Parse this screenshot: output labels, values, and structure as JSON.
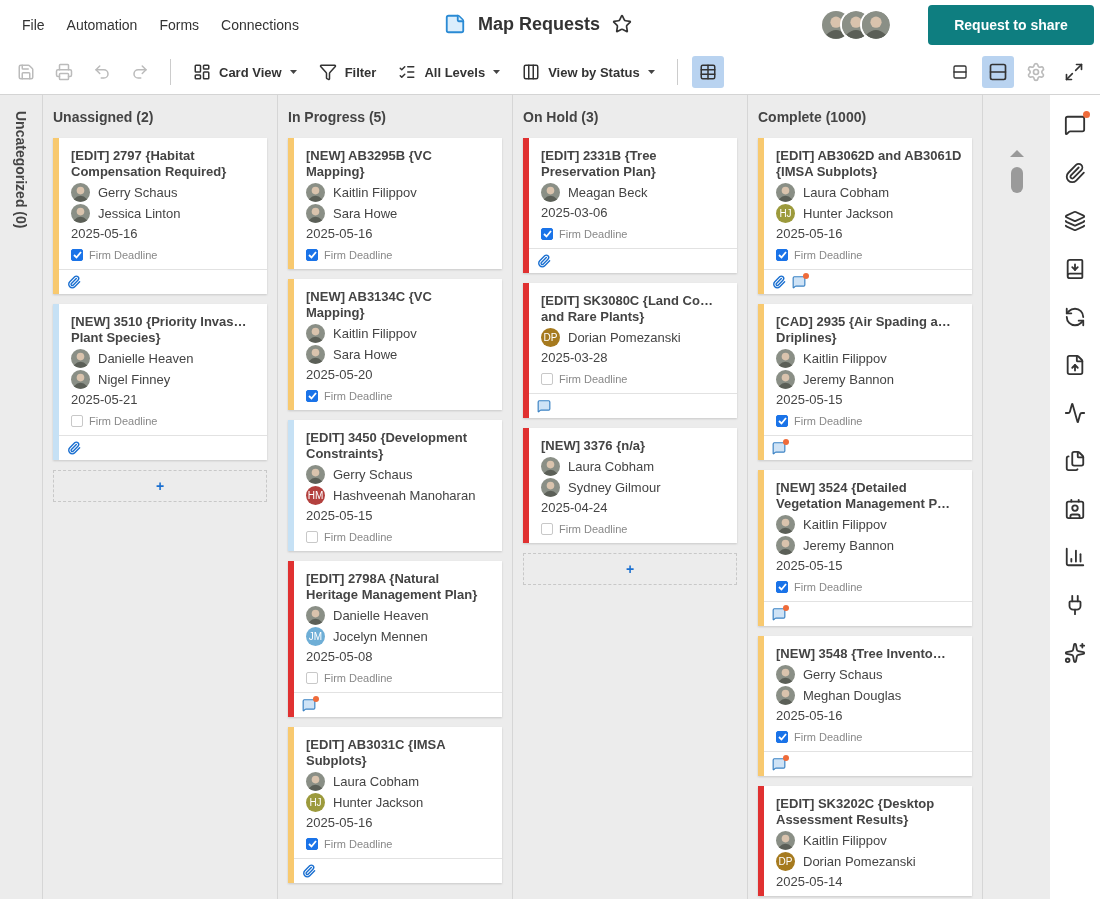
{
  "menu": [
    "File",
    "Automation",
    "Forms",
    "Connections"
  ],
  "title": "Map Requests",
  "starred": false,
  "share_button": "Request to share",
  "collaborators": [
    {
      "kind": "photo"
    },
    {
      "kind": "photo"
    },
    {
      "kind": "photo"
    }
  ],
  "toolbar": {
    "history": [
      {
        "kind": "save",
        "disabled": true
      },
      {
        "kind": "print",
        "disabled": true
      },
      {
        "kind": "undo",
        "disabled": true
      },
      {
        "kind": "redo",
        "disabled": true
      }
    ],
    "controls": [
      {
        "kind": "card-view",
        "label": "Card View",
        "dropdown": true
      },
      {
        "kind": "filter",
        "label": "Filter",
        "dropdown": false
      },
      {
        "kind": "levels",
        "label": "All Levels",
        "dropdown": true
      },
      {
        "kind": "status",
        "label": "View by Status",
        "dropdown": true
      }
    ],
    "grid_toggle": {
      "selected": true
    },
    "right": [
      {
        "kind": "compact",
        "selected": false,
        "disabled": false
      },
      {
        "kind": "expanded",
        "selected": true,
        "disabled": false
      },
      {
        "kind": "settings",
        "selected": false,
        "disabled": true
      },
      {
        "kind": "fullscreen",
        "selected": false,
        "disabled": false
      }
    ]
  },
  "columns": [
    {
      "title": "Uncategorized (0)",
      "collapsed": true
    },
    {
      "title": "Unassigned (2)",
      "collapsed": false,
      "add_label": "+",
      "cards": [
        {
          "title": "[EDIT] 2797 {Habitat Compensation Required}",
          "color": "#f8c96f",
          "people": [
            {
              "name": "Gerry Schaus"
            },
            {
              "name": "Jessica Linton"
            }
          ],
          "date": "2025-05-16",
          "firm_deadline": {
            "label": "Firm Deadline",
            "checked": true
          },
          "footer": [
            {
              "kind": "attachment"
            }
          ]
        },
        {
          "title": "[NEW] 3510 {Priority Invas… Plant Species}",
          "color": "#c6e1f5",
          "people": [
            {
              "name": "Danielle Heaven"
            },
            {
              "name": "Nigel Finney"
            }
          ],
          "date": "2025-05-21",
          "firm_deadline": {
            "label": "Firm Deadline",
            "checked": false
          },
          "footer": [
            {
              "kind": "attachment"
            }
          ]
        }
      ]
    },
    {
      "title": "In Progress (5)",
      "collapsed": false,
      "cards": [
        {
          "title": "[NEW] AB3295B {VC Mapping}",
          "color": "#f8c96f",
          "people": [
            {
              "name": "Kaitlin Filippov"
            },
            {
              "name": "Sara Howe"
            }
          ],
          "date": "2025-05-16",
          "firm_deadline": {
            "label": "Firm Deadline",
            "checked": true
          }
        },
        {
          "title": "[NEW] AB3134C {VC Mapping}",
          "color": "#f8c96f",
          "people": [
            {
              "name": "Kaitlin Filippov"
            },
            {
              "name": "Sara Howe"
            }
          ],
          "date": "2025-05-20",
          "firm_deadline": {
            "label": "Firm Deadline",
            "checked": true
          }
        },
        {
          "title": "[EDIT] 3450 {Development Constraints}",
          "color": "#c6e1f5",
          "people": [
            {
              "name": "Gerry Schaus"
            },
            {
              "name": "Hashveenah Manoharan",
              "initials": "HM",
              "color": "#b3403e"
            }
          ],
          "date": "2025-05-15",
          "firm_deadline": {
            "label": "Firm Deadline",
            "checked": false
          }
        },
        {
          "title": "[EDIT] 2798A {Natural Heritage Management Plan}",
          "color": "#e03131",
          "people": [
            {
              "name": "Danielle Heaven"
            },
            {
              "name": "Jocelyn Mennen",
              "initials": "JM",
              "color": "#6eaed6"
            }
          ],
          "date": "2025-05-08",
          "firm_deadline": {
            "label": "Firm Deadline",
            "checked": false
          },
          "footer": [
            {
              "kind": "comment",
              "unread": true
            }
          ]
        },
        {
          "title": "[EDIT] AB3031C {IMSA Subplots}",
          "color": "#f8c96f",
          "people": [
            {
              "name": "Laura Cobham"
            },
            {
              "name": "Hunter Jackson",
              "initials": "HJ",
              "color": "#9c9a3c"
            }
          ],
          "date": "2025-05-16",
          "firm_deadline": {
            "label": "Firm Deadline",
            "checked": true
          },
          "footer": [
            {
              "kind": "attachment"
            }
          ]
        }
      ]
    },
    {
      "title": "On Hold (3)",
      "collapsed": false,
      "add_label": "+",
      "cards": [
        {
          "title": "[EDIT] 2331B {Tree Preservation Plan}",
          "color": "#e03131",
          "people": [
            {
              "name": "Meagan Beck"
            }
          ],
          "date": "2025-03-06",
          "firm_deadline": {
            "label": "Firm Deadline",
            "checked": true
          },
          "footer": [
            {
              "kind": "attachment"
            }
          ]
        },
        {
          "title": "[EDIT] SK3080C {Land Co… and Rare Plants}",
          "color": "#e03131",
          "people": [
            {
              "name": "Dorian Pomezanski",
              "initials": "DP",
              "color": "#a67a1e"
            }
          ],
          "date": "2025-03-28",
          "firm_deadline": {
            "label": "Firm Deadline",
            "checked": false
          },
          "footer": [
            {
              "kind": "comment",
              "unread": false
            }
          ]
        },
        {
          "title": "[NEW] 3376 {n/a}",
          "color": "#e03131",
          "people": [
            {
              "name": "Laura Cobham"
            },
            {
              "name": "Sydney Gilmour"
            }
          ],
          "date": "2025-04-24",
          "firm_deadline": {
            "label": "Firm Deadline",
            "checked": false
          }
        }
      ]
    },
    {
      "title": "Complete (1000)",
      "collapsed": false,
      "cards": [
        {
          "title": "[EDIT] AB3062D and AB3061D {IMSA Subplots}",
          "color": "#f8c96f",
          "people": [
            {
              "name": "Laura Cobham"
            },
            {
              "name": "Hunter Jackson",
              "initials": "HJ",
              "color": "#9c9a3c"
            }
          ],
          "date": "2025-05-16",
          "firm_deadline": {
            "label": "Firm Deadline",
            "checked": true
          },
          "footer": [
            {
              "kind": "attachment"
            },
            {
              "kind": "comment",
              "unread": true
            }
          ]
        },
        {
          "title": "[CAD] 2935 {Air Spading a… Driplines}",
          "color": "#f8c96f",
          "people": [
            {
              "name": "Kaitlin Filippov"
            },
            {
              "name": "Jeremy Bannon"
            }
          ],
          "date": "2025-05-15",
          "firm_deadline": {
            "label": "Firm Deadline",
            "checked": true
          },
          "footer": [
            {
              "kind": "comment",
              "unread": true
            }
          ]
        },
        {
          "title": "[NEW] 3524 {Detailed Vegetation Management P…",
          "color": "#f8c96f",
          "people": [
            {
              "name": "Kaitlin Filippov"
            },
            {
              "name": "Jeremy Bannon"
            }
          ],
          "date": "2025-05-15",
          "firm_deadline": {
            "label": "Firm Deadline",
            "checked": true
          },
          "footer": [
            {
              "kind": "comment",
              "unread": true
            }
          ]
        },
        {
          "title": "[NEW] 3548 {Tree Invento…",
          "color": "#f8c96f",
          "people": [
            {
              "name": "Gerry Schaus"
            },
            {
              "name": "Meghan Douglas"
            }
          ],
          "date": "2025-05-16",
          "firm_deadline": {
            "label": "Firm Deadline",
            "checked": true
          },
          "footer": [
            {
              "kind": "comment",
              "unread": true
            }
          ]
        },
        {
          "title": "[EDIT] SK3202C {Desktop Assessment Results}",
          "color": "#e03131",
          "people": [
            {
              "name": "Kaitlin Filippov"
            },
            {
              "name": "Dorian Pomezanski",
              "initials": "DP",
              "color": "#a67a1e"
            }
          ],
          "date": "2025-05-14"
        }
      ]
    }
  ],
  "sidebar": {
    "unread_comments": true
  }
}
